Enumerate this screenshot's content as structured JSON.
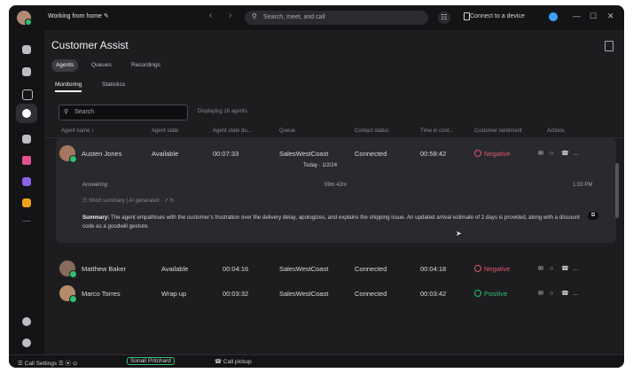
{
  "titlebar": {
    "status": "Working from home ✎",
    "nav": "‹ ›",
    "search_placeholder": "Search, meet, and call",
    "dialpad_icon": "☷",
    "connect_label": "Connect to a device",
    "window_controls": [
      "—",
      "☐",
      "✕"
    ]
  },
  "page": {
    "title": "Customer Assist",
    "tabs": [
      "Agents",
      "Queues",
      "Recordings"
    ],
    "subtabs": [
      "Monitoring",
      "Statistics"
    ],
    "search_placeholder": "Search",
    "displaying": "Displaying 16 agents"
  },
  "table": {
    "headers": [
      "Agent name ↕",
      "Agent state",
      "Agent state du...",
      "Queue",
      "Contact status",
      "Time in cont...",
      "Customer sentiment",
      "Actions"
    ],
    "rows": [
      {
        "name": "Austen Jones",
        "state": "Available",
        "duration": "00:07:33",
        "queue": "SalesWestCoast",
        "contact": "Connected",
        "time": "00:58:42",
        "sentiment": "Negative",
        "sentiment_color": "#e0566b"
      },
      {
        "name": "Matthew Baker",
        "state": "Available",
        "duration": "00:04:16",
        "queue": "SalesWestCoast",
        "contact": "Connected",
        "time": "00:04:18",
        "sentiment": "Negative",
        "sentiment_color": "#e0566b"
      },
      {
        "name": "Marco Torres",
        "state": "Wrap up",
        "duration": "00:03:32",
        "queue": "SalesWestCoast",
        "contact": "Connected",
        "time": "00:03:42",
        "sentiment": "Positive",
        "sentiment_color": "#2fbf71"
      }
    ],
    "action_icons": [
      "✉",
      "○",
      "☎",
      "…"
    ]
  },
  "expanded": {
    "date": "Today · 1/2/24",
    "answering": "Answering",
    "duration": "59m 42m",
    "time": "1:33 PM",
    "summary_meta": "☷ Short summary | AI generated · ↗ ↻",
    "summary_label": "Summary:",
    "summary_text": " The agent empathises with the customer’s frustration over the delivery delay, apologizes, and explains the shipping issue. An updated arrival estimate of 2 days is provided, along with a discount code as a goodwill gesture."
  },
  "bottombar": {
    "call_settings": "☰ Call Settings ☰ ⦿ ⊙",
    "contact": "Sonali Pritchard",
    "pickup": "☎ Call pickup"
  },
  "colors": {
    "window_bg": "#1b1b1d",
    "card_bg": "#2a2a2e",
    "available": "#2fbf71",
    "negative": "#e0566b",
    "positive": "#2fbf71",
    "brand": "#3fa0ff"
  }
}
